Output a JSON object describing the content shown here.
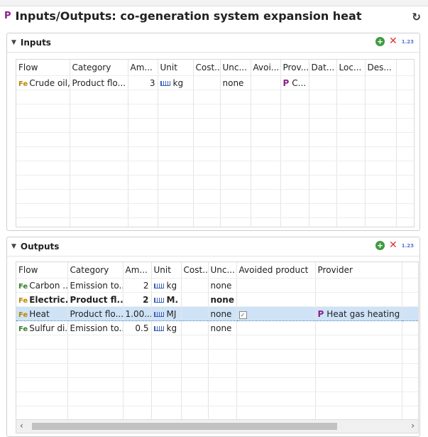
{
  "header": {
    "icon_letter": "P",
    "title": "Inputs/Outputs: co-generation system expansion heat",
    "refresh_icon": "refresh-icon"
  },
  "inputs": {
    "title": "Inputs",
    "format_label": "1.23",
    "columns": [
      "Flow",
      "Category",
      "Am...",
      "Unit",
      "Cost...",
      "Unc...",
      "Avoi...",
      "Prov...",
      "Dat...",
      "Loc...",
      "Des..."
    ],
    "rows": [
      {
        "flow": "Crude oil,...",
        "category": "Product flo...",
        "amount": "3",
        "unit": "kg",
        "cost": "",
        "uncertainty": "none",
        "avoided": "",
        "provider": "C...",
        "data": "",
        "location": "",
        "description": ""
      }
    ]
  },
  "outputs": {
    "title": "Outputs",
    "format_label": "1.23",
    "columns": [
      "Flow",
      "Category",
      "Am...",
      "Unit",
      "Cost...",
      "Unc...",
      "Avoided product",
      "Provider"
    ],
    "rows": [
      {
        "flow": "Carbon ...",
        "category": "Emission to...",
        "amount": "2",
        "unit": "kg",
        "cost": "",
        "uncertainty": "none",
        "avoided": "",
        "provider": "",
        "bold": false,
        "selected": false,
        "flow_type": "elementary"
      },
      {
        "flow": "Electric...",
        "category": "Product fl...",
        "amount": "2",
        "unit": "M.",
        "cost": "",
        "uncertainty": "none",
        "avoided": "",
        "provider": "",
        "bold": true,
        "selected": false,
        "flow_type": "product"
      },
      {
        "flow": "Heat",
        "category": "Product flo...",
        "amount": "1.00...",
        "unit": "MJ",
        "cost": "",
        "uncertainty": "none",
        "avoided": "checked",
        "provider": "Heat gas heating",
        "bold": false,
        "selected": true,
        "flow_type": "product"
      },
      {
        "flow": "Sulfur di...",
        "category": "Emission to...",
        "amount": "0.5",
        "unit": "kg",
        "cost": "",
        "uncertainty": "none",
        "avoided": "",
        "provider": "",
        "bold": false,
        "selected": false,
        "flow_type": "elementary"
      }
    ]
  }
}
